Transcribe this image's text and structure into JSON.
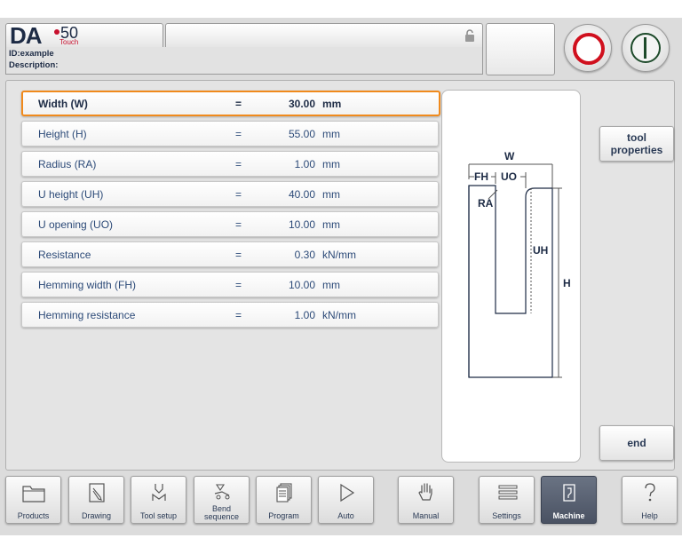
{
  "header": {
    "logo": {
      "brand": "DA",
      "model": "50",
      "edition": "Touch"
    },
    "id_line": "ID:example",
    "description_line": "Description:"
  },
  "parameters": [
    {
      "label": "Width (W)",
      "eq": "=",
      "value": "30.00",
      "unit": "mm",
      "selected": true
    },
    {
      "label": "Height (H)",
      "eq": "=",
      "value": "55.00",
      "unit": "mm"
    },
    {
      "label": "Radius (RA)",
      "eq": "=",
      "value": "1.00",
      "unit": "mm"
    },
    {
      "label": "U height (UH)",
      "eq": "=",
      "value": "40.00",
      "unit": "mm"
    },
    {
      "label": "U opening (UO)",
      "eq": "=",
      "value": "10.00",
      "unit": "mm"
    },
    {
      "label": "Resistance",
      "eq": "=",
      "value": "0.30",
      "unit": "kN/mm"
    },
    {
      "label": "Hemming width (FH)",
      "eq": "=",
      "value": "10.00",
      "unit": "mm"
    },
    {
      "label": "Hemming resistance",
      "eq": "=",
      "value": "1.00",
      "unit": "kN/mm"
    }
  ],
  "drawing": {
    "labels": {
      "w": "W",
      "fh": "FH",
      "uo": "UO",
      "ra": "RA",
      "uh": "UH",
      "h": "H"
    }
  },
  "side_buttons": {
    "tool_properties": "tool properties",
    "end": "end"
  },
  "nav": [
    {
      "label": "Products",
      "icon": "folder-icon"
    },
    {
      "label": "Drawing",
      "icon": "pencil-icon"
    },
    {
      "label": "Tool setup",
      "icon": "tool-setup-icon"
    },
    {
      "label": "Bend sequence",
      "icon": "bend-sequence-icon"
    },
    {
      "label": "Program",
      "icon": "program-icon"
    },
    {
      "label": "Auto",
      "icon": "play-icon"
    },
    {
      "label": "Manual",
      "icon": "hand-icon"
    },
    {
      "label": "Settings",
      "icon": "settings-list-icon"
    },
    {
      "label": "Machine",
      "icon": "machine-icon",
      "active": true
    },
    {
      "label": "Help",
      "icon": "help-icon"
    }
  ],
  "colors": {
    "accent_selected": "#f08a1c",
    "stop_red": "#d0101e",
    "start_green": "#1d4a2a",
    "active_nav": "#4a5263"
  }
}
